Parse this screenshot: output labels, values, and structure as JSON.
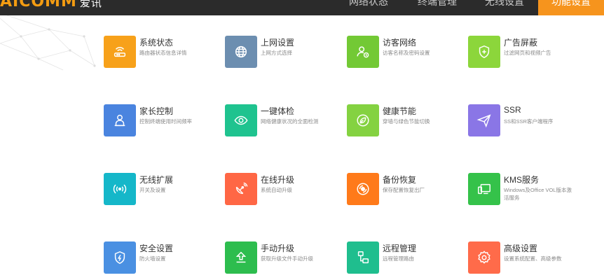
{
  "brand": {
    "logo": "AICOMM",
    "subtitle": "爱讯"
  },
  "nav": {
    "items": [
      "网络状态",
      "终端管理",
      "无线设置"
    ],
    "active": "功能设置"
  },
  "colors": {
    "nav_bg": "#2b2b2b",
    "accent": "#f6941d"
  },
  "tiles": [
    {
      "title": "系统状态",
      "desc": "路由器状态信息详情",
      "icon": "router-icon",
      "color": "#f7a11a"
    },
    {
      "title": "上网设置",
      "desc": "上网方式选择",
      "icon": "globe-icon",
      "color": "#6c8eb0"
    },
    {
      "title": "访客网络",
      "desc": "访客名称及密码设置",
      "icon": "guest-user-icon",
      "color": "#73c935"
    },
    {
      "title": "广告屏蔽",
      "desc": "过滤网页和视频广告",
      "icon": "shield-plus-icon",
      "color": "#8cd63b"
    },
    {
      "title": "家长控制",
      "desc": "控制终端使用时间频率",
      "icon": "parent-user-icon",
      "color": "#4a84df"
    },
    {
      "title": "一键体检",
      "desc": "网络健康状况的全面检测",
      "icon": "eye-icon",
      "color": "#1fc38f"
    },
    {
      "title": "健康节能",
      "desc": "穿墙与绿色节能切换",
      "icon": "leaf-icon",
      "color": "#84d241"
    },
    {
      "title": "SSR",
      "desc": "SS和SSR客户端程序",
      "icon": "paper-plane-icon",
      "color": "#8a76e6"
    },
    {
      "title": "无线扩展",
      "desc": "开关及设置",
      "icon": "wifi-extend-icon",
      "color": "#15b7c9"
    },
    {
      "title": "在线升级",
      "desc": "系统自动升级",
      "icon": "satellite-icon",
      "color": "#ff6745"
    },
    {
      "title": "备份恢复",
      "desc": "保存配置恢复出厂",
      "icon": "backup-icon",
      "color": "#ff7a1a"
    },
    {
      "title": "KMS服务",
      "desc": "Windows及Office VOL版本激活服务",
      "icon": "kms-device-icon",
      "color": "#35c24a"
    },
    {
      "title": "安全设置",
      "desc": "防火墙设置",
      "icon": "security-shield-icon",
      "color": "#4a90e2"
    },
    {
      "title": "手动升级",
      "desc": "获取升级文件手动升级",
      "icon": "upload-icon",
      "color": "#2dbd4e"
    },
    {
      "title": "远程管理",
      "desc": "远程管理路由",
      "icon": "remote-network-icon",
      "color": "#1fbe8e"
    },
    {
      "title": "高级设置",
      "desc": "设置系统配置、高级参数",
      "icon": "gear-icon",
      "color": "#ff6b4a"
    }
  ]
}
